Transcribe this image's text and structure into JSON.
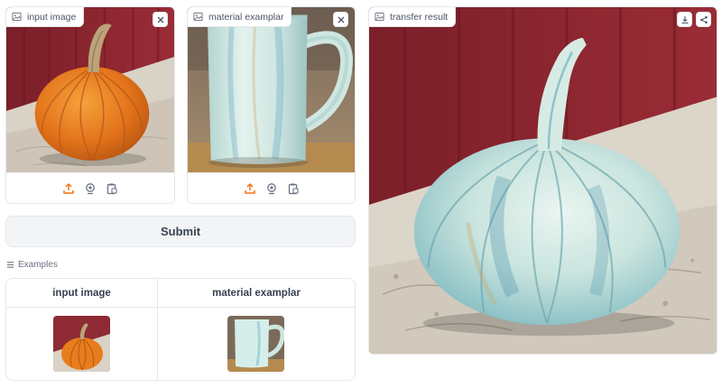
{
  "inputs": {
    "input_image": {
      "label": "input image",
      "clear_icon": "close-icon"
    },
    "material_exemplar": {
      "label": "material examplar",
      "clear_icon": "close-icon"
    }
  },
  "toolbar_icons": [
    "upload-icon",
    "webcam-icon",
    "clipboard-paste-icon"
  ],
  "submit": {
    "label": "Submit"
  },
  "examples": {
    "title": "Examples",
    "headers": [
      "input image",
      "material examplar"
    ],
    "rows": [
      [
        "orange-pumpkin-thumbnail",
        "glazed-mug-thumbnail"
      ]
    ]
  },
  "output": {
    "label": "transfer result",
    "actions": [
      "download-icon",
      "share-icon"
    ]
  },
  "colors": {
    "accent_orange": "#f97316",
    "barn_red": "#8e2a33",
    "pumpkin_orange": "#e87d1c",
    "glaze_mint": "#d6eee9",
    "glaze_teal": "#6cb2c3",
    "button_bg": "#f3f4f6",
    "border": "#e5e7eb"
  }
}
